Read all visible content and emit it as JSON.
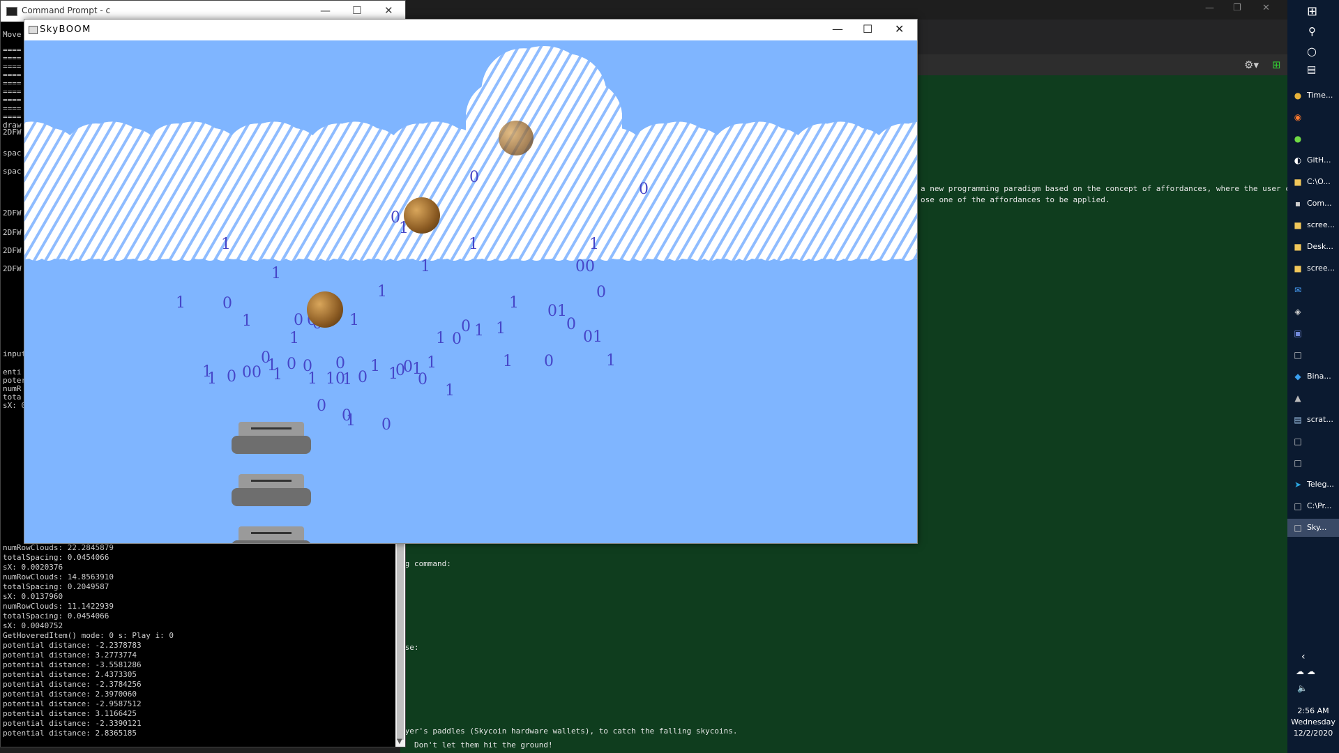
{
  "editor": {
    "text_lines": [
      {
        "text": "a new programming paradigm based on the concept of affordances, where the user can ask"
      },
      {
        "text": "ose one of the affordances to be applied."
      },
      {
        "text": "ng command:"
      },
      {
        "text": "use:"
      },
      {
        "text": "ayer's paddles (Skycoin hardware wallets), to catch the falling skycoins."
      },
      {
        "text": "Don't let them hit the ground!"
      }
    ]
  },
  "cmd": {
    "title": "Command Prompt - c",
    "lines_top": [
      "Move",
      "====",
      "====",
      "====",
      "====",
      "====",
      "====",
      "====",
      "====",
      "====",
      "draw",
      "2DFW",
      "spac",
      "spac",
      "2DFW",
      "2DFW",
      "2DFW",
      "2DFW",
      "input",
      "enti",
      "poter",
      "numR",
      "tota",
      "sX: 0"
    ],
    "lines": [
      "numRowClouds: 22.2845879",
      "totalSpacing: 0.0454066",
      "sX: 0.0020376",
      "numRowClouds: 14.8563910",
      "totalSpacing: 0.2049587",
      "sX: 0.0137960",
      "numRowClouds: 11.1422939",
      "totalSpacing: 0.0454066",
      "sX: 0.0040752",
      "GetHoveredItem() mode: 0 s: Play i: 0",
      "potential distance: -2.2378783",
      "potential distance: 3.2773774",
      "potential distance: -3.5581286",
      "potential distance: 2.4373305",
      "potential distance: -2.3784256",
      "potential distance: 2.3970060",
      "potential distance: -2.9587512",
      "potential distance: 3.1166425",
      "potential distance: -2.3390121",
      "potential distance: 2.8365185"
    ]
  },
  "game": {
    "title": "SkyBOOM",
    "background_color": "#7fb5ff",
    "binary_digits": [
      {
        "t": "0"
      },
      {
        "t": "0"
      },
      {
        "t": "0"
      },
      {
        "t": "1"
      },
      {
        "t": "1"
      },
      {
        "t": "1"
      },
      {
        "t": "1"
      },
      {
        "t": "1"
      },
      {
        "t": "00"
      },
      {
        "t": "1"
      },
      {
        "t": "1"
      },
      {
        "t": "0"
      },
      {
        "t": "1"
      },
      {
        "t": "0"
      },
      {
        "t": "1"
      },
      {
        "t": "1"
      },
      {
        "t": "01"
      },
      {
        "t": "1"
      },
      {
        "t": "0"
      },
      {
        "t": "0"
      },
      {
        "t": "0"
      },
      {
        "t": "1"
      },
      {
        "t": "0"
      },
      {
        "t": "0"
      },
      {
        "t": "1"
      },
      {
        "t": "1"
      },
      {
        "t": "0"
      },
      {
        "t": "1"
      },
      {
        "t": "01"
      },
      {
        "t": "1"
      },
      {
        "t": "0"
      },
      {
        "t": "1"
      },
      {
        "t": "0"
      },
      {
        "t": "0"
      },
      {
        "t": "1"
      },
      {
        "t": "1"
      },
      {
        "t": "0"
      },
      {
        "t": "1"
      },
      {
        "t": "1"
      },
      {
        "t": "1"
      },
      {
        "t": "0"
      },
      {
        "t": "00"
      },
      {
        "t": "1"
      },
      {
        "t": "0"
      },
      {
        "t": "1"
      },
      {
        "t": "10"
      },
      {
        "t": "1"
      },
      {
        "t": "0"
      },
      {
        "t": "1"
      },
      {
        "t": "0"
      },
      {
        "t": "0"
      },
      {
        "t": "1"
      },
      {
        "t": "0"
      },
      {
        "t": "1"
      },
      {
        "t": "1"
      },
      {
        "t": "0"
      },
      {
        "t": "0"
      },
      {
        "t": "1"
      },
      {
        "t": "0"
      }
    ]
  },
  "taskbar": {
    "items": [
      {
        "icon": "chrome-icon",
        "label": "Time..."
      },
      {
        "icon": "firefox-icon",
        "label": ""
      },
      {
        "icon": "upwork-icon",
        "label": ""
      },
      {
        "icon": "github-icon",
        "label": "GitH..."
      },
      {
        "icon": "folder-icon",
        "label": "C:\\O..."
      },
      {
        "icon": "cmd-icon",
        "label": "Com..."
      },
      {
        "icon": "folder-icon",
        "label": "scree..."
      },
      {
        "icon": "folder-icon",
        "label": "Desk..."
      },
      {
        "icon": "folder-icon",
        "label": "scree..."
      },
      {
        "icon": "mail-icon",
        "label": ""
      },
      {
        "icon": "network-icon",
        "label": ""
      },
      {
        "icon": "discord-icon",
        "label": ""
      },
      {
        "icon": "app-icon",
        "label": ""
      },
      {
        "icon": "vscode-icon",
        "label": "Bina..."
      },
      {
        "icon": "bird-icon",
        "label": ""
      },
      {
        "icon": "notepad-icon",
        "label": "scrat..."
      },
      {
        "icon": "app-icon",
        "label": ""
      },
      {
        "icon": "app-icon",
        "label": ""
      },
      {
        "icon": "telegram-icon",
        "label": "Teleg..."
      },
      {
        "icon": "app-icon",
        "label": "C:\\Pr..."
      },
      {
        "icon": "app-icon",
        "label": "Sky..."
      }
    ],
    "time": "2:56 AM",
    "day": "Wednesday",
    "date": "12/2/2020"
  }
}
